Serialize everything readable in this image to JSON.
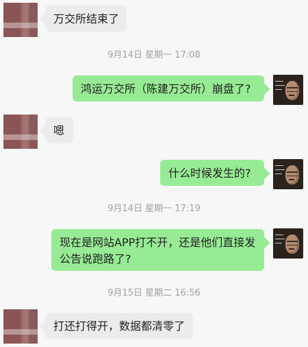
{
  "messages": [
    {
      "side": "left",
      "text": "万交所结束了"
    },
    {
      "side": "right",
      "text": "鸿运万交所（陈建万交所）崩盘了?"
    },
    {
      "side": "left",
      "text": "嗯"
    },
    {
      "side": "right",
      "text": "什么时候发生的?"
    },
    {
      "side": "right",
      "text": "现在是网站APP打不开，还是他们直接发公告说跑路了?"
    },
    {
      "side": "left",
      "text": "打还打得开，数据都清零了"
    }
  ],
  "timestamps": [
    "9月14日 星期一 17:08",
    "9月14日 星期一 17:19",
    "9月15日 星期二 16:56"
  ],
  "colors": {
    "background": "#f7f7f7",
    "bubble_left": "#ececec",
    "bubble_right": "#98eb95",
    "timestamp": "#a0a0a0"
  }
}
